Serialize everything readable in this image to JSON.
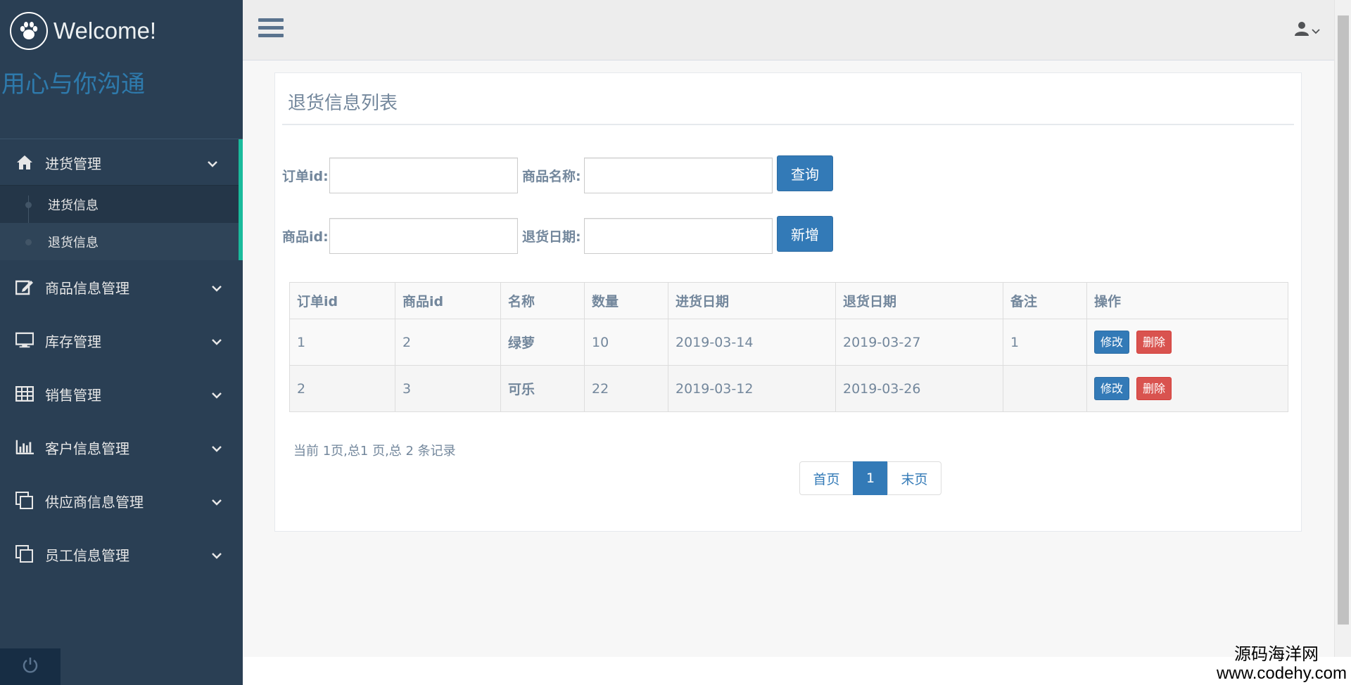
{
  "brand": {
    "title": "Welcome!",
    "slogan": "用心与你沟通"
  },
  "sidebar": {
    "menu": [
      {
        "label": "进货管理",
        "icon": "home-icon",
        "expanded": true,
        "children": [
          {
            "label": "进货信息"
          },
          {
            "label": "退货信息"
          }
        ]
      },
      {
        "label": "商品信息管理",
        "icon": "edit-icon"
      },
      {
        "label": "库存管理",
        "icon": "desktop-icon"
      },
      {
        "label": "销售管理",
        "icon": "table-icon"
      },
      {
        "label": "客户信息管理",
        "icon": "bar-chart-icon"
      },
      {
        "label": "供应商信息管理",
        "icon": "clone-icon"
      },
      {
        "label": "员工信息管理",
        "icon": "clone-icon"
      }
    ]
  },
  "panel": {
    "title": "退货信息列表"
  },
  "search": {
    "order_id_label": "订单id:",
    "goods_name_label": "商品名称:",
    "goods_id_label": "商品id:",
    "return_date_label": "退货日期:",
    "order_id_value": "",
    "goods_name_value": "",
    "goods_id_value": "",
    "return_date_value": "",
    "query_button": "查询",
    "add_button": "新增"
  },
  "table": {
    "headers": [
      "订单id",
      "商品id",
      "名称",
      "数量",
      "进货日期",
      "退货日期",
      "备注",
      "操作"
    ],
    "rows": [
      {
        "order_id": "1",
        "goods_id": "2",
        "name": "绿萝",
        "qty": "10",
        "purchase_date": "2019-03-14",
        "return_date": "2019-03-27",
        "remark": "1"
      },
      {
        "order_id": "2",
        "goods_id": "3",
        "name": "可乐",
        "qty": "22",
        "purchase_date": "2019-03-12",
        "return_date": "2019-03-26",
        "remark": ""
      }
    ],
    "edit_label": "修改",
    "delete_label": "删除"
  },
  "pagination": {
    "info": "当前 1页,总1 页,总 2 条记录",
    "first": "首页",
    "current": "1",
    "last": "末页"
  },
  "watermark": {
    "line1": "源码海洋网",
    "line2": "www.codehy.com"
  },
  "colors": {
    "sidebar": "#2a3f54",
    "accent": "#1abb9c",
    "primary": "#337ab7",
    "danger": "#d9534f"
  }
}
